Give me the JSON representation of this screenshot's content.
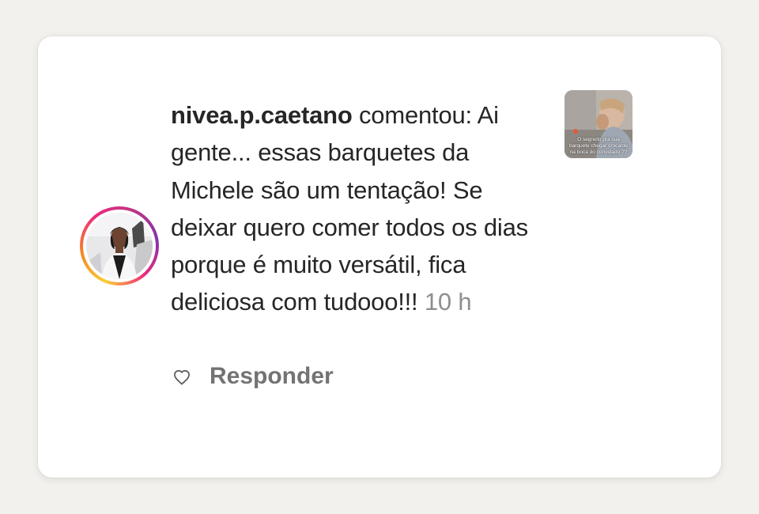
{
  "comment": {
    "username": "nivea.p.caetano",
    "action": " comentou: ",
    "text": "Ai gente... essas barquetes da Michele são um tentação! Se deixar quero comer todos os dias porque é muito versátil, fica deliciosa com tudooo!!! ",
    "time": "10 h"
  },
  "actions": {
    "reply_label": "Responder"
  },
  "thumbnail": {
    "caption": "O segredo pra sua barquete chegar crocante na boca do convidado ??"
  },
  "colors": {
    "username": "#262626",
    "text": "#262626",
    "muted": "#8e8e8e",
    "reply": "#737373",
    "ring_gradient": [
      "#f9ce34",
      "#ee2a7b",
      "#6228d7"
    ]
  },
  "icons": {
    "heart": "heart-outline-icon"
  }
}
